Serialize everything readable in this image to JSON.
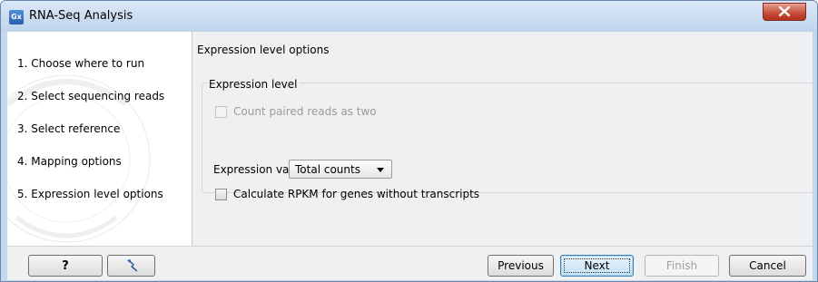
{
  "window": {
    "title": "RNA-Seq Analysis",
    "app_icon_text": "Gx"
  },
  "steps": [
    {
      "label": "1.  Choose where to run"
    },
    {
      "label": "2.  Select sequencing reads"
    },
    {
      "label": "3.  Select reference"
    },
    {
      "label": "4.  Mapping options"
    },
    {
      "label": "5.  Expression level options"
    }
  ],
  "content": {
    "title": "Expression level options",
    "group_title": "Expression level",
    "count_paired_label": "Count paired reads as two",
    "count_paired_checked": false,
    "expression_value_label": "Expression value",
    "expression_value_selected": "Total counts",
    "rpkm_label": "Calculate RPKM for genes without transcripts",
    "rpkm_checked": false
  },
  "footer": {
    "help_label": "?",
    "previous_label": "Previous",
    "next_label": "Next",
    "finish_label": "Finish",
    "cancel_label": "Cancel"
  },
  "icons": {
    "app": "app-logo-icon",
    "close": "close-icon",
    "help": "help-icon",
    "reset": "reset-arrow-icon"
  }
}
